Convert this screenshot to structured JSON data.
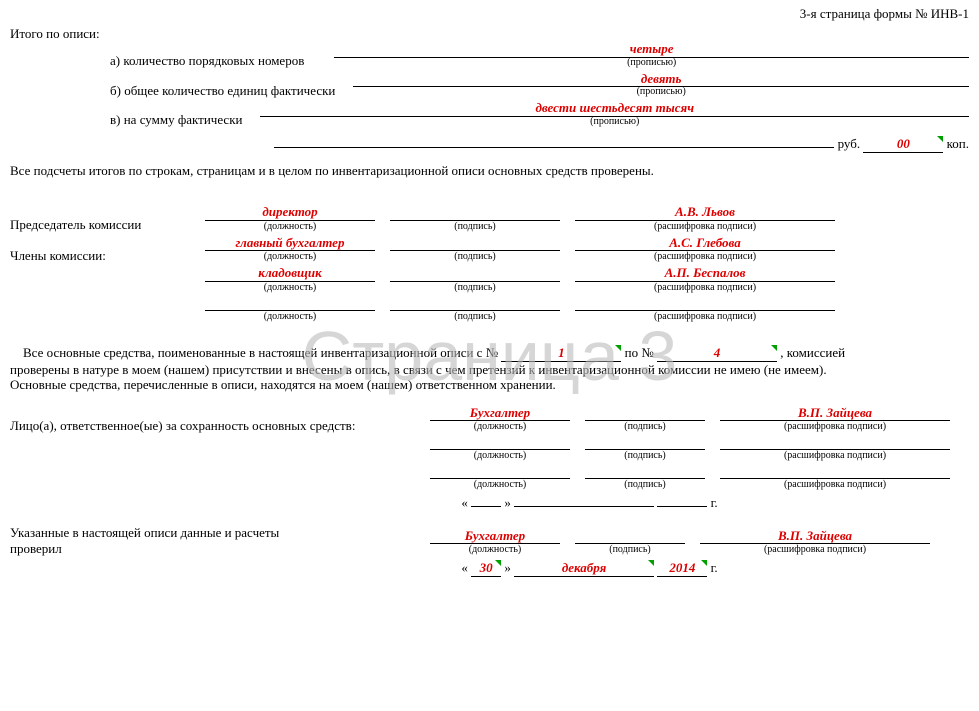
{
  "header": {
    "page_label": "3-я страница формы № ИНВ-1"
  },
  "watermark": "Страница 3",
  "totals": {
    "title": "Итого по описи:",
    "a_label": "а) количество порядковых номеров",
    "a_value": "четыре",
    "a_caption": "(прописью)",
    "b_label": "б) общее количество единиц фактически",
    "b_value": "девять",
    "b_caption": "(прописью)",
    "c_label": "в) на сумму фактически",
    "c_value": "двести шестьдесят тысяч",
    "c_caption": "(прописью)",
    "rub_label": "руб.",
    "kop_value": "00",
    "kop_label": "коп."
  },
  "verify_text": "Все подсчеты итогов по строкам, страницам и в целом по инвентаризационной описи основных средств проверены.",
  "chairman": {
    "label": "Председатель комиссии",
    "position": "директор",
    "name": "А.В. Львов"
  },
  "members": {
    "label": "Члены комиссии:",
    "rows": [
      {
        "position": "главный бухгалтер",
        "name": "А.С. Глебова"
      },
      {
        "position": "кладовщик",
        "name": "А.П. Беспалов"
      },
      {
        "position": "",
        "name": ""
      }
    ]
  },
  "sig_captions": {
    "position": "(должность)",
    "sign": "(подпись)",
    "name": "(расшифровка подписи)"
  },
  "assets_text": {
    "part1": "Все основные средства, поименованные в настоящей инвентаризационной описи с №",
    "from": "1",
    "part2": "по №",
    "to": "4",
    "part3": ", комиссией",
    "line2": "проверены в натуре в моем (нашем) присутствии и внесены в опись, в связи с чем претензий к инвентаризационной комиссии не имею (не имеем).",
    "line3": "Основные средства, перечисленные в описи, находятся на моем (нашем) ответственном хранении."
  },
  "responsible": {
    "label": "Лицо(а), ответственное(ые) за сохранность основных средств:",
    "rows": [
      {
        "position": "Бухгалтер",
        "name": "В.П. Зайцева"
      },
      {
        "position": "",
        "name": ""
      },
      {
        "position": "",
        "name": ""
      }
    ]
  },
  "resp_date": {
    "open": "«",
    "d": "",
    "close": "»",
    "m": "",
    "y": "",
    "g": "г."
  },
  "checker": {
    "label": "Указанные в настоящей описи данные и расчеты проверил",
    "position": "Бухгалтер",
    "name": "В.П. Зайцева",
    "date": {
      "open": "«",
      "d": "30",
      "close": "»",
      "m": "декабря",
      "y": "2014",
      "g": "г."
    }
  }
}
